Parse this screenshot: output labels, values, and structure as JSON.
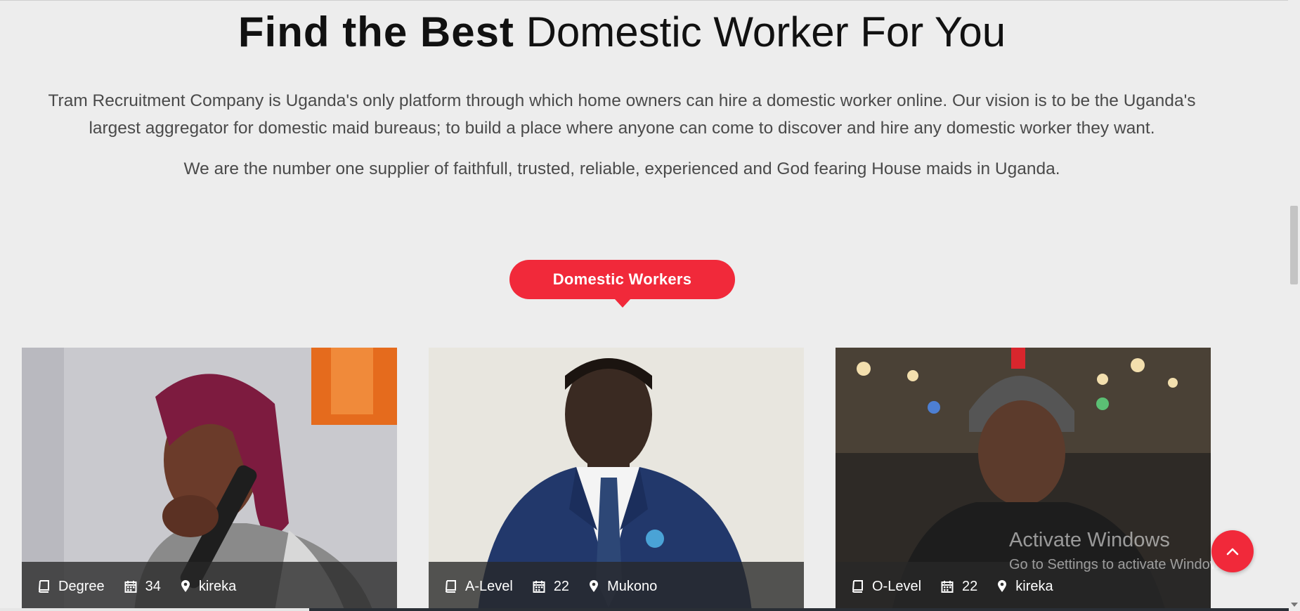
{
  "hero": {
    "title_bold": "Find the Best",
    "title_rest": "Domestic Worker For You",
    "intro_line1": "Tram Recruitment Company is Uganda's only platform through which home owners can hire a domestic worker online. Our vision is to be the Uganda's",
    "intro_line2": "largest aggregator for domestic maid bureaus; to build a place where anyone can come to discover and hire any domestic worker they want.",
    "tagline": "We are the number one supplier of faithfull, trusted, reliable, experienced and God fearing House maids in Uganda."
  },
  "section": {
    "badge": "Domestic Workers"
  },
  "workers": [
    {
      "education": "Degree",
      "age": "34",
      "location": "kireka"
    },
    {
      "education": "A-Level",
      "age": "22",
      "location": "Mukono"
    },
    {
      "education": "O-Level",
      "age": "22",
      "location": "kireka"
    }
  ],
  "watermark": {
    "line1": "Activate Windows",
    "line2": "Go to Settings to activate Windows."
  },
  "colors": {
    "accent": "#f1293a",
    "background": "#ededed"
  },
  "icons": [
    "book-icon",
    "calendar-icon",
    "map-pin-icon",
    "chevron-up-icon"
  ]
}
